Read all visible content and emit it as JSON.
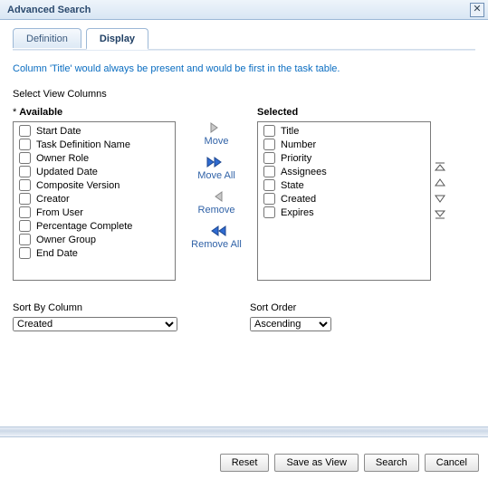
{
  "window": {
    "title": "Advanced Search"
  },
  "tabs": {
    "definition": "Definition",
    "display": "Display"
  },
  "hint": "Column 'Title' would always be present and would be first in the task table.",
  "section_label": "Select View Columns",
  "available": {
    "header": "Available",
    "items": [
      "Start Date",
      "Task Definition Name",
      "Owner Role",
      "Updated Date",
      "Composite Version",
      "Creator",
      "From User",
      "Percentage Complete",
      "Owner Group",
      "End Date"
    ]
  },
  "selected": {
    "header": "Selected",
    "items": [
      "Title",
      "Number",
      "Priority",
      "Assignees",
      "State",
      "Created",
      "Expires"
    ]
  },
  "move_controls": {
    "move": "Move",
    "move_all": "Move All",
    "remove": "Remove",
    "remove_all": "Remove All"
  },
  "sort": {
    "by_label": "Sort By Column",
    "by_value": "Created",
    "order_label": "Sort Order",
    "order_value": "Ascending"
  },
  "buttons": {
    "reset": "Reset",
    "save_as_view": "Save as View",
    "search": "Search",
    "cancel": "Cancel"
  }
}
